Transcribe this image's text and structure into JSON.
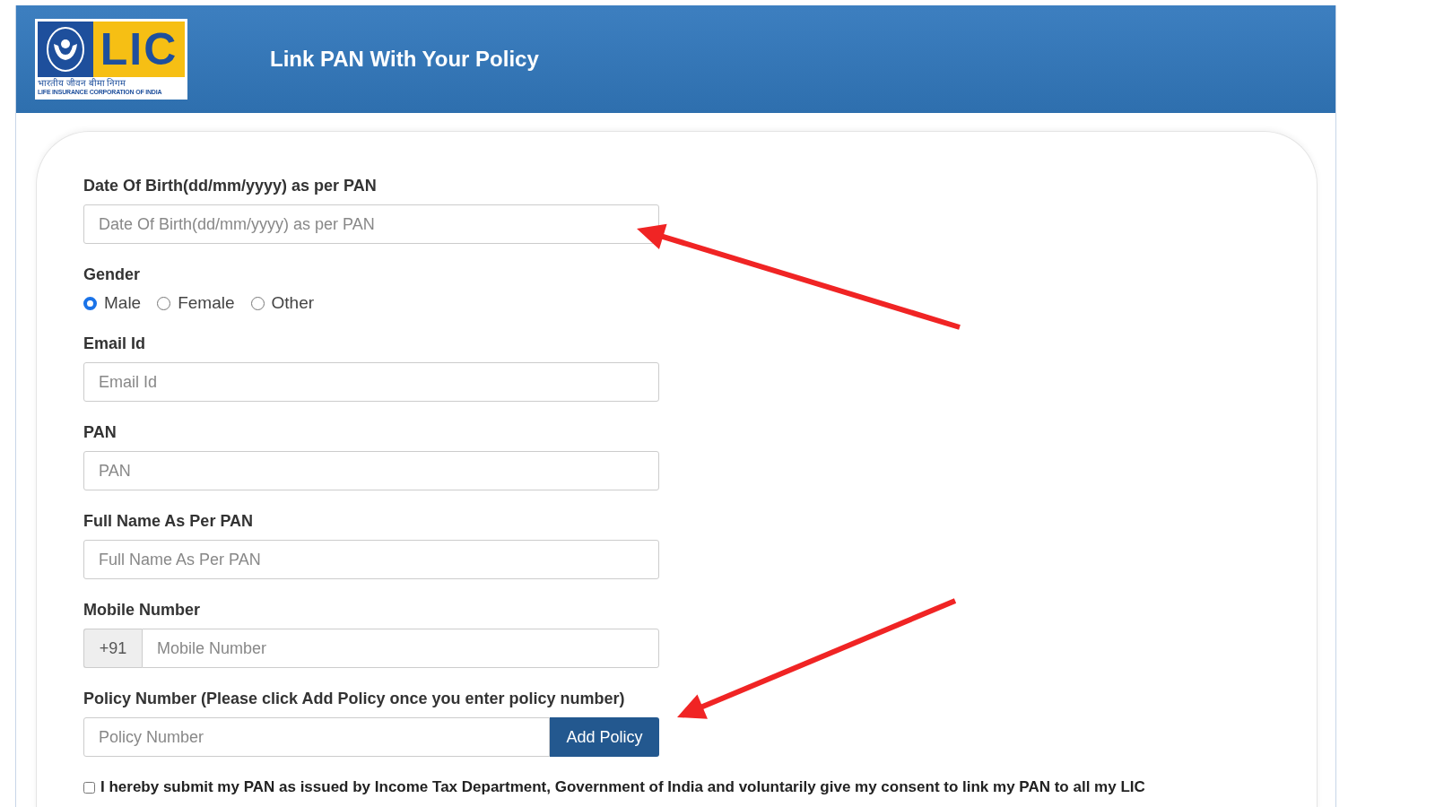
{
  "header": {
    "logo": {
      "brand": "LIC",
      "hindi": "भारतीय जीवन बीमा निगम",
      "english": "LIFE INSURANCE CORPORATION OF INDIA"
    },
    "title": "Link PAN With Your Policy"
  },
  "form": {
    "dob": {
      "label": "Date Of Birth(dd/mm/yyyy) as per PAN",
      "placeholder": "Date Of Birth(dd/mm/yyyy) as per PAN"
    },
    "gender": {
      "label": "Gender",
      "options": [
        {
          "label": "Male",
          "selected": true
        },
        {
          "label": "Female",
          "selected": false
        },
        {
          "label": "Other",
          "selected": false
        }
      ]
    },
    "email": {
      "label": "Email Id",
      "placeholder": "Email Id"
    },
    "pan": {
      "label": "PAN",
      "placeholder": "PAN"
    },
    "name": {
      "label": "Full Name As Per PAN",
      "placeholder": "Full Name As Per PAN"
    },
    "mobile": {
      "label": "Mobile Number",
      "prefix": "+91",
      "placeholder": "Mobile Number"
    },
    "policy": {
      "label": "Policy Number (Please click Add Policy once you enter policy number)",
      "placeholder": "Policy Number",
      "button": "Add Policy"
    },
    "consent": {
      "checked": false,
      "text": "I hereby submit my PAN as issued by Income Tax Department, Government of India and voluntarily give my consent to link my PAN to all my LIC"
    }
  }
}
